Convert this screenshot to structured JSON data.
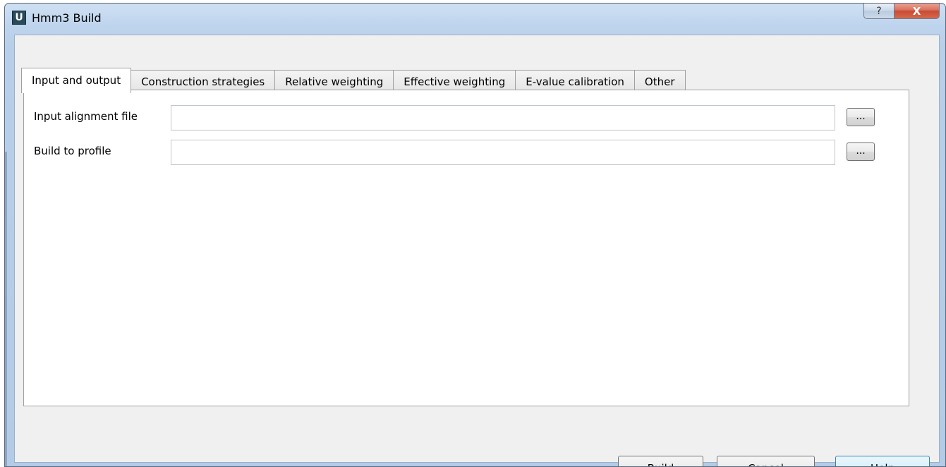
{
  "window": {
    "title": "Hmm3 Build",
    "app_icon_letter": "U",
    "help_caption": "?",
    "close_caption": "X"
  },
  "tabs": [
    {
      "label": "Input and output",
      "active": true
    },
    {
      "label": "Construction strategies",
      "active": false
    },
    {
      "label": "Relative weighting",
      "active": false
    },
    {
      "label": "Effective weighting",
      "active": false
    },
    {
      "label": "E-value calibration",
      "active": false
    },
    {
      "label": "Other",
      "active": false
    }
  ],
  "form": {
    "input_alignment": {
      "label": "Input alignment file",
      "value": "",
      "browse_label": "..."
    },
    "build_to_profile": {
      "label": "Build to profile",
      "value": "",
      "browse_label": "..."
    }
  },
  "buttons": {
    "build": "Build",
    "cancel": "Cancel",
    "help": "Help"
  },
  "colors": {
    "title_bar": "#bfd5ee",
    "client_bg": "#f0f0f0",
    "close_button": "#c94a32",
    "focused_button": "#3c7fb1"
  }
}
